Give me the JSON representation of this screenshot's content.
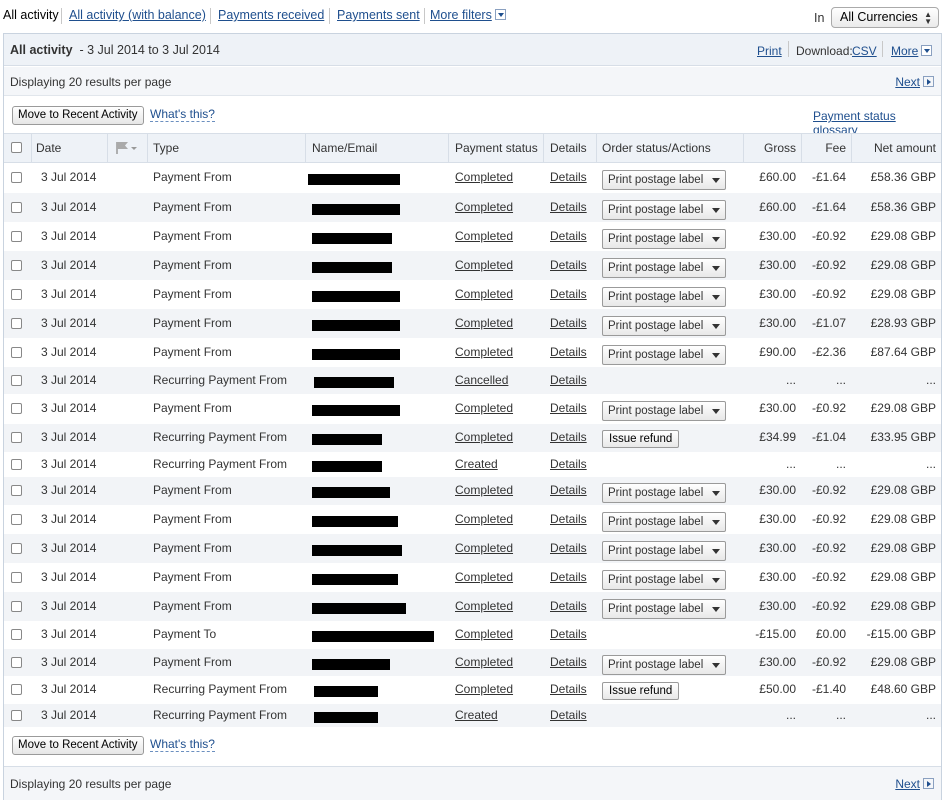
{
  "tabs": {
    "all_activity": "All activity",
    "with_balance": "All activity (with balance)",
    "received": "Payments received",
    "sent": "Payments sent",
    "more_filters": "More filters"
  },
  "currency": {
    "label": "In",
    "selected": "All Currencies"
  },
  "title_bar": {
    "title": "All activity",
    "range": "- 3 Jul 2014 to 3 Jul 2014",
    "print": "Print",
    "download_label": "Download:",
    "csv": "CSV",
    "more": "More"
  },
  "display_text": "Displaying 20 results per page",
  "next_label": "Next",
  "actions": {
    "move_button": "Move to Recent Activity",
    "whats_this": "What's this?",
    "glossary": "Payment status glossary"
  },
  "columns": {
    "date": "Date",
    "type": "Type",
    "name": "Name/Email",
    "status": "Payment status",
    "details": "Details",
    "order": "Order status/Actions",
    "gross": "Gross",
    "fee": "Fee",
    "net": "Net amount"
  },
  "rows": [
    {
      "date": "3 Jul 2014",
      "type": "Payment From",
      "status": "Completed",
      "details": "Details",
      "action": "Print postage label",
      "gross": "£60.00",
      "fee": "-£1.64",
      "net": "£58.36 GBP"
    },
    {
      "date": "3 Jul 2014",
      "type": "Payment From",
      "status": "Completed",
      "details": "Details",
      "action": "Print postage label",
      "gross": "£60.00",
      "fee": "-£1.64",
      "net": "£58.36 GBP"
    },
    {
      "date": "3 Jul 2014",
      "type": "Payment From",
      "status": "Completed",
      "details": "Details",
      "action": "Print postage label",
      "gross": "£30.00",
      "fee": "-£0.92",
      "net": "£29.08 GBP"
    },
    {
      "date": "3 Jul 2014",
      "type": "Payment From",
      "status": "Completed",
      "details": "Details",
      "action": "Print postage label",
      "gross": "£30.00",
      "fee": "-£0.92",
      "net": "£29.08 GBP"
    },
    {
      "date": "3 Jul 2014",
      "type": "Payment From",
      "status": "Completed",
      "details": "Details",
      "action": "Print postage label",
      "gross": "£30.00",
      "fee": "-£0.92",
      "net": "£29.08 GBP"
    },
    {
      "date": "3 Jul 2014",
      "type": "Payment From",
      "status": "Completed",
      "details": "Details",
      "action": "Print postage label",
      "gross": "£30.00",
      "fee": "-£1.07",
      "net": "£28.93 GBP"
    },
    {
      "date": "3 Jul 2014",
      "type": "Payment From",
      "status": "Completed",
      "details": "Details",
      "action": "Print postage label",
      "gross": "£90.00",
      "fee": "-£2.36",
      "net": "£87.64 GBP"
    },
    {
      "date": "3 Jul 2014",
      "type": "Recurring Payment From",
      "status": "Cancelled",
      "details": "Details",
      "action": "",
      "gross": "...",
      "fee": "...",
      "net": "..."
    },
    {
      "date": "3 Jul 2014",
      "type": "Payment From",
      "status": "Completed",
      "details": "Details",
      "action": "Print postage label",
      "gross": "£30.00",
      "fee": "-£0.92",
      "net": "£29.08 GBP"
    },
    {
      "date": "3 Jul 2014",
      "type": "Recurring Payment From",
      "status": "Completed",
      "details": "Details",
      "action": "Issue refund",
      "gross": "£34.99",
      "fee": "-£1.04",
      "net": "£33.95 GBP"
    },
    {
      "date": "3 Jul 2014",
      "type": "Recurring Payment From",
      "status": "Created",
      "details": "Details",
      "action": "",
      "gross": "...",
      "fee": "...",
      "net": "..."
    },
    {
      "date": "3 Jul 2014",
      "type": "Payment From",
      "status": "Completed",
      "details": "Details",
      "action": "Print postage label",
      "gross": "£30.00",
      "fee": "-£0.92",
      "net": "£29.08 GBP"
    },
    {
      "date": "3 Jul 2014",
      "type": "Payment From",
      "status": "Completed",
      "details": "Details",
      "action": "Print postage label",
      "gross": "£30.00",
      "fee": "-£0.92",
      "net": "£29.08 GBP"
    },
    {
      "date": "3 Jul 2014",
      "type": "Payment From",
      "status": "Completed",
      "details": "Details",
      "action": "Print postage label",
      "gross": "£30.00",
      "fee": "-£0.92",
      "net": "£29.08 GBP"
    },
    {
      "date": "3 Jul 2014",
      "type": "Payment From",
      "status": "Completed",
      "details": "Details",
      "action": "Print postage label",
      "gross": "£30.00",
      "fee": "-£0.92",
      "net": "£29.08 GBP"
    },
    {
      "date": "3 Jul 2014",
      "type": "Payment From",
      "status": "Completed",
      "details": "Details",
      "action": "Print postage label",
      "gross": "£30.00",
      "fee": "-£0.92",
      "net": "£29.08 GBP"
    },
    {
      "date": "3 Jul 2014",
      "type": "Payment To",
      "status": "Completed",
      "details": "Details",
      "action": "",
      "gross": "-£15.00",
      "fee": "£0.00",
      "net": "-£15.00 GBP"
    },
    {
      "date": "3 Jul 2014",
      "type": "Payment From",
      "status": "Completed",
      "details": "Details",
      "action": "Print postage label",
      "gross": "£30.00",
      "fee": "-£0.92",
      "net": "£29.08 GBP"
    },
    {
      "date": "3 Jul 2014",
      "type": "Recurring Payment From",
      "status": "Completed",
      "details": "Details",
      "action": "Issue refund",
      "gross": "£50.00",
      "fee": "-£1.40",
      "net": "£48.60 GBP"
    },
    {
      "date": "3 Jul 2014",
      "type": "Recurring Payment From",
      "status": "Created",
      "details": "Details",
      "action": "",
      "gross": "...",
      "fee": "...",
      "net": "..."
    }
  ],
  "colors": {
    "link": "#1f4f8e",
    "header_bg": "#eef2f7",
    "row_alt": "#f2f4f7",
    "redaction": "#000000"
  },
  "icons": {
    "flag": "flag-icon",
    "dropdown": "chevron-down-icon",
    "next": "next-arrow-icon"
  }
}
